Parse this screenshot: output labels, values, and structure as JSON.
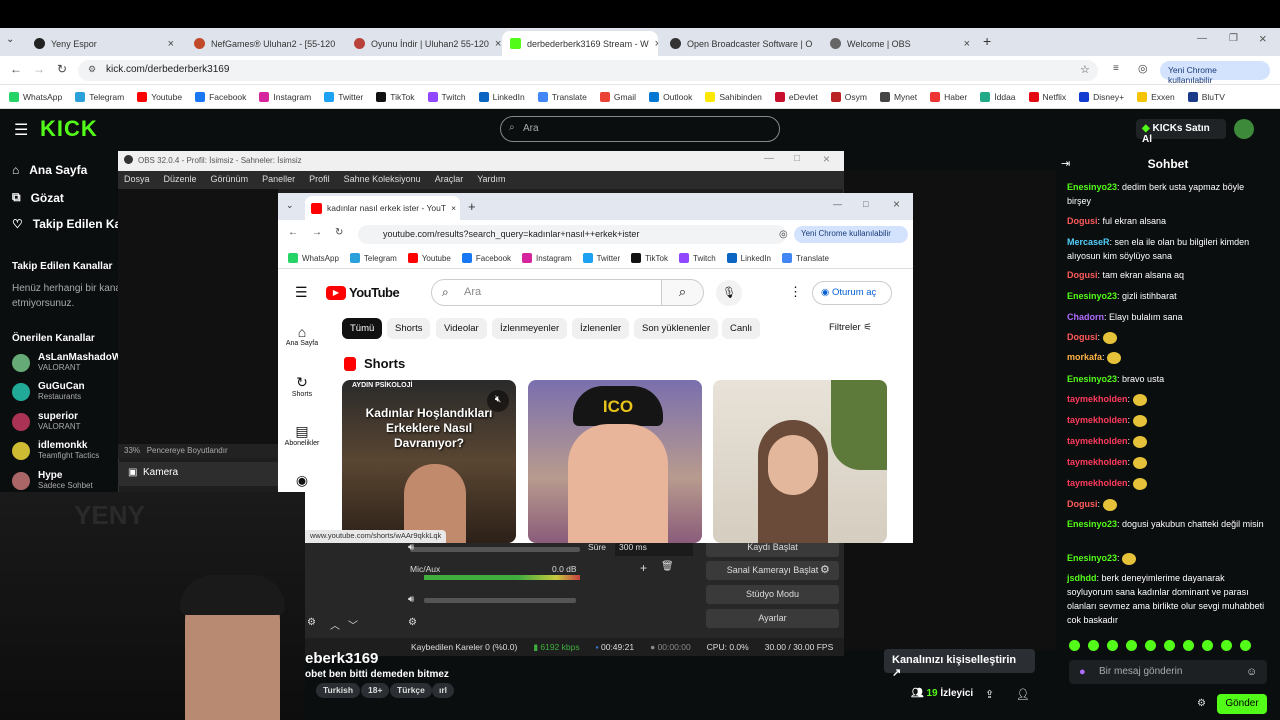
{
  "browser": {
    "tabs": [
      {
        "label": "Yeny Espor",
        "color": "#222"
      },
      {
        "label": "NefGames® Uluhan2 - [55-120",
        "color": "#c14a2a"
      },
      {
        "label": "Oyunu İndir | Uluhan2 55-120",
        "color": "#b8413a"
      },
      {
        "label": "derbederberk3169 Stream - W",
        "color": "#53fc18"
      },
      {
        "label": "Open Broadcaster Software | O",
        "color": "#333"
      },
      {
        "label": "Welcome | OBS",
        "color": "#666"
      }
    ],
    "url": "kick.com/derbederberk3169",
    "profile_label": "Yeni Chrome kullanılabilir",
    "bookmarks": [
      {
        "label": "WhatsApp",
        "color": "#25d366"
      },
      {
        "label": "Telegram",
        "color": "#2aa1da"
      },
      {
        "label": "Youtube",
        "color": "#ff0000"
      },
      {
        "label": "Facebook",
        "color": "#1877f2"
      },
      {
        "label": "Instagram",
        "color": "#d6249f"
      },
      {
        "label": "Twitter",
        "color": "#1da1f2"
      },
      {
        "label": "TikTok",
        "color": "#111"
      },
      {
        "label": "Twitch",
        "color": "#9146ff"
      },
      {
        "label": "LinkedIn",
        "color": "#0a66c2"
      },
      {
        "label": "Translate",
        "color": "#4285f4"
      },
      {
        "label": "Gmail",
        "color": "#ea4335"
      },
      {
        "label": "Outlook",
        "color": "#0078d4"
      },
      {
        "label": "Sahibinden",
        "color": "#ffe800"
      },
      {
        "label": "eDevlet",
        "color": "#c8102e"
      },
      {
        "label": "Osym",
        "color": "#b22"
      },
      {
        "label": "Mynet",
        "color": "#444"
      },
      {
        "label": "Haber",
        "color": "#e33"
      },
      {
        "label": "İddaa",
        "color": "#2a8"
      },
      {
        "label": "Netflix",
        "color": "#e50914"
      },
      {
        "label": "Disney+",
        "color": "#113ccf"
      },
      {
        "label": "Exxen",
        "color": "#f5c400"
      },
      {
        "label": "BluTV",
        "color": "#1b3b8a"
      }
    ]
  },
  "kick": {
    "search_placeholder": "Ara",
    "buy_label": "KICKs Satın Al",
    "nav": [
      "Ana Sayfa",
      "Gözat",
      "Takip Edilen Kanallar"
    ],
    "followed_title": "Takip Edilen Kanallar",
    "followed_empty_1": "Henüz herhangi bir kanalı",
    "followed_empty_2": "etmiyorsunuz.",
    "recommended_title": "Önerilen Kanallar",
    "channels": [
      {
        "name": "AsLanMashadoW",
        "category": "VALORANT",
        "color": "#6a7"
      },
      {
        "name": "GuGuCan",
        "category": "Restaurants",
        "color": "#2a9"
      },
      {
        "name": "superior",
        "category": "VALORANT",
        "color": "#a35"
      },
      {
        "name": "idlemonkk",
        "category": "Teamfight Tactics",
        "color": "#cb3"
      },
      {
        "name": "Hype",
        "category": "Sadece Sohbet",
        "color": "#a66"
      }
    ],
    "streamer_name": "eberk3169",
    "stream_title": "obet ben bitti demeden bitmez",
    "tags": [
      "Turkish",
      "18+",
      "Türkçe",
      "ırl"
    ],
    "customize_label": "Kanalınızı kişiselleştirin",
    "viewers": "19",
    "viewers_label": "İzleyici"
  },
  "chat": {
    "title": "Sohbet",
    "messages": [
      {
        "user": "Enesinyo23",
        "text": "dedim berk usta yapmaz böyle birşey",
        "color": "#53fc18"
      },
      {
        "user": "Dogusi",
        "text": "ful ekran alsana",
        "color": "#ff5a5a"
      },
      {
        "user": "MercaseR",
        "text": "sen ela ile olan bu bilgileri kimden alıyosun kim söylüyo sana",
        "color": "#53d0fc"
      },
      {
        "user": "Dogusi",
        "text": "tam ekran alsana aq",
        "color": "#ff5a5a"
      },
      {
        "user": "Enesinyo23",
        "text": "gizli istihbarat",
        "color": "#53fc18"
      },
      {
        "user": "Chadorn",
        "text": "Elayı bulalım sana",
        "color": "#b06cff"
      },
      {
        "user": "Dogusi",
        "text": "",
        "color": "#ff5a5a"
      },
      {
        "user": "morkafa",
        "text": "",
        "color": "#ffb347"
      },
      {
        "user": "Enesinyo23",
        "text": "bravo usta",
        "color": "#53fc18"
      },
      {
        "user": "taymekholden",
        "text": "",
        "color": "#ff3b5c"
      },
      {
        "user": "taymekholden",
        "text": "",
        "color": "#ff3b5c"
      },
      {
        "user": "taymekholden",
        "text": "",
        "color": "#ff3b5c"
      },
      {
        "user": "taymekholden",
        "text": "",
        "color": "#ff3b5c"
      },
      {
        "user": "taymekholden",
        "text": "",
        "color": "#ff3b5c"
      },
      {
        "user": "Dogusi",
        "text": "",
        "color": "#ff5a5a"
      },
      {
        "user": "Enesinyo23",
        "text": "dogusi yakubun chatteki değil misin",
        "color": "#53fc18"
      },
      {
        "user": "Enesinyo23",
        "text": "",
        "color": "#53fc18"
      },
      {
        "user": "jsdhdd",
        "text": "berk deneyimlerime dayanarak soyluyorum sana kadınlar dominant ve parası olanları sevmez ama birlikte olur sevgi muhabbeti cok baskadır",
        "color": "#53fc18"
      }
    ],
    "input_placeholder": "Bir mesaj gönderin",
    "send_label": "Gönder"
  },
  "obs": {
    "title": "OBS 32.0.4 - Profil: İsimsiz - Sahneler: İsimsiz",
    "menu": [
      "Dosya",
      "Düzenle",
      "Görünüm",
      "Paneller",
      "Profil",
      "Sahne Koleksiyonu",
      "Araçlar",
      "Yardım"
    ],
    "zoom": "33%",
    "fit_label": "Pencereye Boyutlandır",
    "source": "Kamera",
    "mic_label": "Mic/Aux",
    "mic_db": "0.0 dB",
    "duration_label": "Süre",
    "duration_value": "300 ms",
    "buttons": [
      "Kaydı Başlat",
      "Sanal Kamerayı Başlat",
      "Stüdyo Modu",
      "Ayarlar"
    ],
    "status": {
      "dropped": "Kaybedilen Kareler 0 (%0.0)",
      "bitrate": "6192 kbps",
      "live": "00:49:21",
      "rec": "00:00:00",
      "cpu": "CPU: 0.0%",
      "fps": "30.00 / 30.00 FPS"
    }
  },
  "youtube": {
    "tab_title": "kadınlar nasıl erkek ister - YouT",
    "url": "youtube.com/results?search_query=kadınlar+nasıl++erkek+ister",
    "profile_label": "Yeni Chrome kullanılabilir",
    "bookmarks": [
      "WhatsApp",
      "Telegram",
      "Youtube",
      "Facebook",
      "Instagram",
      "Twitter",
      "TikTok",
      "Twitch",
      "LinkedIn",
      "Translate"
    ],
    "search_placeholder": "Ara",
    "signin": "Oturum aç",
    "chips": [
      "Tümü",
      "Shorts",
      "Videolar",
      "İzlenmeyenler",
      "İzlenenler",
      "Son yüklenenler",
      "Canlı"
    ],
    "filters": "Filtreler",
    "side": [
      "Ana Sayfa",
      "Shorts",
      "Abonelikler"
    ],
    "shorts_title": "Shorts",
    "thumb1_caption": "Kadınlar Hoşlandıkları Erkeklere Nasıl Davranıyor?",
    "thumb1_brand": "AYDIN PSİKOLOJİ",
    "status_url": "www.youtube.com/shorts/wAAr9qkkLqk"
  }
}
